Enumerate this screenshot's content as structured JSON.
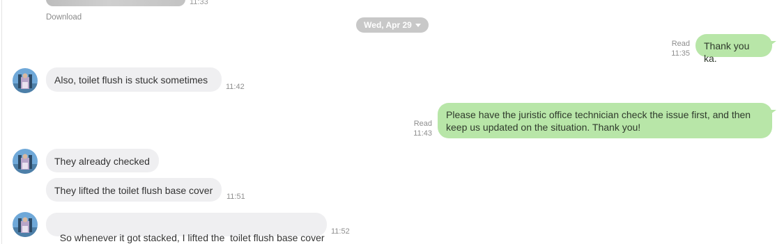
{
  "previous": {
    "time": "11:33",
    "download_label": "Download"
  },
  "date_divider": {
    "label": "Wed, Apr 29"
  },
  "messages": [
    {
      "direction": "out",
      "text": "Thank you ka.",
      "status": "Read",
      "time": "11:35"
    },
    {
      "direction": "in",
      "text": "Also, toilet flush is stuck sometimes",
      "time": "11:42"
    },
    {
      "direction": "out",
      "text": "Please have the juristic office technician check the issue first, and then keep us updated on the situation. Thank you!",
      "status": "Read",
      "time": "11:43"
    },
    {
      "direction": "in",
      "text": "They already checked",
      "time": ""
    },
    {
      "direction": "in",
      "text": "They lifted the toilet flush base cover",
      "time": "11:51"
    },
    {
      "direction": "in",
      "text": "So whenever it got stacked, I lifted the  toilet flush base cover",
      "time": "11:52"
    }
  ],
  "colors": {
    "incoming_bubble": "#efeff1",
    "outgoing_bubble": "#b8e6a8",
    "date_chip": "#c8c8c8"
  }
}
